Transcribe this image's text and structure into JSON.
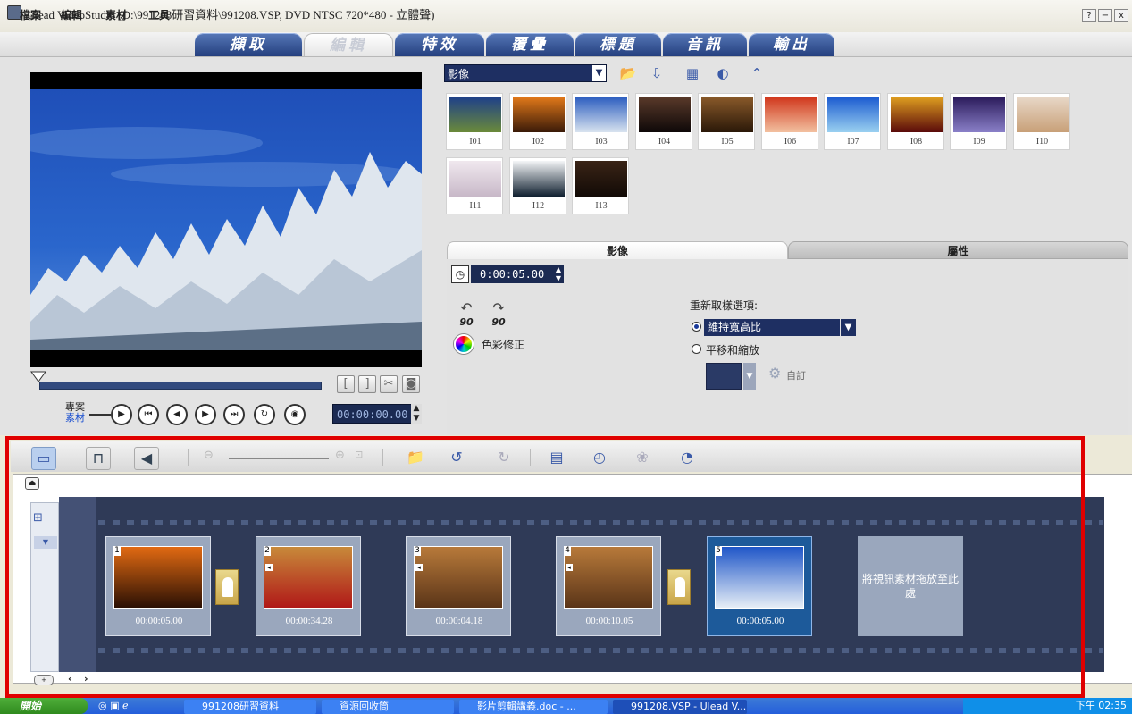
{
  "window": {
    "title": "Ulead VideoStudio (D:\\991208研習資料\\991208.VSP, DVD NTSC 720*480 - 立體聲)",
    "help": "?",
    "minimize": "−",
    "close": "x"
  },
  "menu": [
    "檔案",
    "編輯",
    "素材",
    "工具"
  ],
  "steps": [
    "擷取",
    "編輯",
    "特效",
    "覆疊",
    "標題",
    "音訊",
    "輸出"
  ],
  "active_step": "編輯",
  "preview": {
    "project_label": "專案",
    "clip_label": "素材",
    "timecode": "00:00:00.00"
  },
  "library": {
    "category": "影像",
    "thumbs": [
      {
        "label": "I01",
        "c1": "#1d3f8a",
        "c2": "#6b8a3a"
      },
      {
        "label": "I02",
        "c1": "#e47a1a",
        "c2": "#3a1a08"
      },
      {
        "label": "I03",
        "c1": "#2a5cbf",
        "c2": "#d8e3ef"
      },
      {
        "label": "I04",
        "c1": "#5a3a2a",
        "c2": "#0e0808"
      },
      {
        "label": "I05",
        "c1": "#8a5a2a",
        "c2": "#2a1808"
      },
      {
        "label": "I06",
        "c1": "#d0351a",
        "c2": "#f2c0a0"
      },
      {
        "label": "I07",
        "c1": "#1a5ad0",
        "c2": "#9ad0f0"
      },
      {
        "label": "I08",
        "c1": "#e0a020",
        "c2": "#5a0a0a"
      },
      {
        "label": "I09",
        "c1": "#2a1a5a",
        "c2": "#8a80c8"
      },
      {
        "label": "I10",
        "c1": "#e8d8c8",
        "c2": "#c8a078"
      },
      {
        "label": "I11",
        "c1": "#f0e8ee",
        "c2": "#c8b8c8"
      },
      {
        "label": "I12",
        "c1": "#f4f6f8",
        "c2": "#102030"
      },
      {
        "label": "I13",
        "c1": "#3a2416",
        "c2": "#120a06"
      }
    ]
  },
  "options": {
    "tab_image": "影像",
    "tab_attributes": "屬性",
    "duration": "0:00:05.00",
    "rotate_left": "90",
    "rotate_right": "90",
    "color_correction": "色彩修正",
    "resample_heading": "重新取樣選項:",
    "resample_selected": "維持寬高比",
    "option_keep_ratio": "維持寬高比",
    "option_pan_zoom": "平移和縮放",
    "custom": "自訂"
  },
  "timeline": {
    "clips": [
      {
        "num": "1",
        "time": "00:00:05.00",
        "audio": false,
        "selected": false,
        "c1": "#e26a12",
        "c2": "#2a1004"
      },
      {
        "num": "2",
        "time": "00:00:34.28",
        "audio": true,
        "selected": false,
        "c1": "#c88a3a",
        "c2": "#b01818"
      },
      {
        "num": "3",
        "time": "00:00:04.18",
        "audio": true,
        "selected": false,
        "c1": "#b87a3a",
        "c2": "#5a3418"
      },
      {
        "num": "4",
        "time": "00:00:10.05",
        "audio": true,
        "selected": false,
        "c1": "#b87a3a",
        "c2": "#5a3418"
      },
      {
        "num": "5",
        "time": "00:00:05.00",
        "audio": false,
        "selected": true,
        "c1": "#1f56c8",
        "c2": "#e6eef6"
      }
    ],
    "drop_hint": "將視訊素材拖放至此處"
  },
  "taskbar": {
    "start": "開始",
    "items": [
      "991208研習資料",
      "資源回收筒",
      "影片剪輯講義.doc - ...",
      "991208.VSP - Ulead V..."
    ],
    "clock": "下午 02:35"
  }
}
